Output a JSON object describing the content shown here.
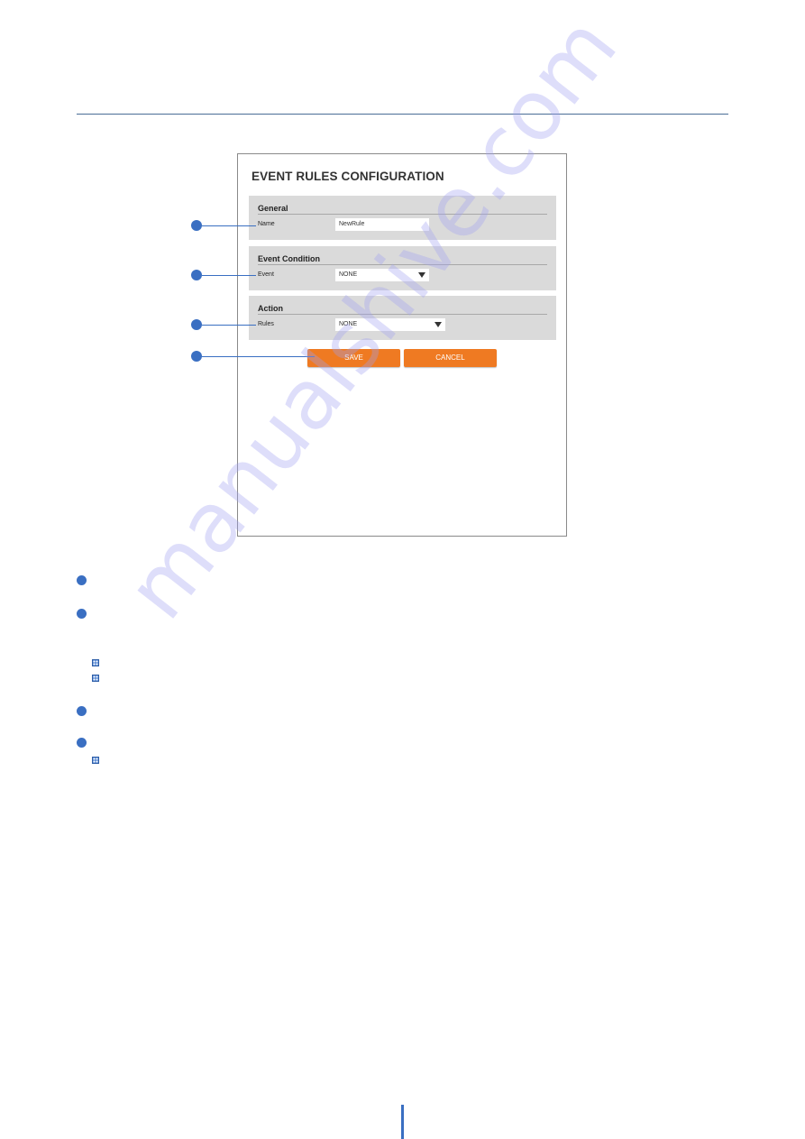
{
  "document": {
    "watermark": "manualshive.com"
  },
  "dialog": {
    "title": "EVENT RULES CONFIGURATION",
    "sections": {
      "general": {
        "heading": "General",
        "name_label": "Name",
        "name_value": "NewRule"
      },
      "event_condition": {
        "heading": "Event Condition",
        "event_label": "Event",
        "event_selected": "NONE"
      },
      "action": {
        "heading": "Action",
        "rules_label": "Rules",
        "rules_selected": "NONE"
      }
    },
    "buttons": {
      "save": "SAVE",
      "cancel": "CANCEL"
    },
    "colors": {
      "accent_button": "#ef7a22",
      "callout": "#3a6fc2",
      "section_bg": "#dadada"
    }
  },
  "callouts": [
    {
      "target": "Name"
    },
    {
      "target": "Event"
    },
    {
      "target": "Rules"
    },
    {
      "target": "SAVE"
    }
  ]
}
